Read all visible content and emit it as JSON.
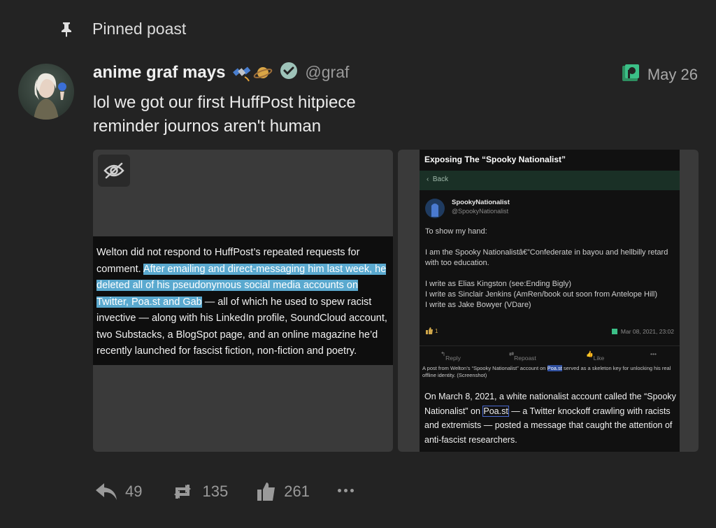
{
  "pinned": {
    "icon": "pin-icon",
    "label": "Pinned poast"
  },
  "post": {
    "author_name": "anime graf mays",
    "emoji": [
      "satellite-emoji",
      "ringed-planet-emoji"
    ],
    "verified_icon": "verified-check-icon",
    "handle": "@graf",
    "date": "May 26",
    "source_icon": "poast-logo-icon",
    "content_lines": [
      "lol we got our first HuffPost hitpiece",
      "reminder journos aren't human"
    ],
    "accent": "#3bbf87"
  },
  "media_left": {
    "hide_icon": "eye-slash-icon",
    "text_pre": "Welton did not respond to HuffPost’s repeated requests for comment.",
    "text_hl1": "After emailing and direct-messaging him last week, he deleted ",
    "text_hl2": "all",
    "text_hl3": " of his pseudonymous social media accounts on Twitter, Poa.st and Gab",
    "text_post": " — all of which he used to spew racist invective — along with his LinkedIn profile, SoundCloud account, two Substacks, a BlogSpot page, and an online magazine he’d recently launched for fascist fiction, non-fiction and poetry."
  },
  "media_right": {
    "title": "Exposing The “Spooky Nationalist”",
    "back": "Back",
    "user_name": "SpookyNationalist",
    "user_handle": "@SpookyNationalist",
    "line1": "To show my hand:",
    "line2": "I am the Spooky Nationalistâ€”Confederate in bayou and hellbilly retard with too education.",
    "line3": "I write as Elias Kingston (see:Ending Bigly)",
    "line4": "I write as Sinclair Jenkins (AmRen/book out soon from Antelope Hill)",
    "line5": "I write as Jake Bowyer (VDare)",
    "like_count": "1",
    "timestamp": "Mar 08, 2021, 23:02",
    "reply": "Reply",
    "repoast": "Repoast",
    "like": "Like",
    "more": "•••",
    "caption_pre": "A post from Welton’s “Spooky Nationalist” account on ",
    "caption_link": "Poa.st",
    "caption_post": " served as a skeleton key for unlocking his real offline identity. (Screenshot)",
    "para_pre": "On March 8, 2021, a white nationalist account called the “Spooky Nationalist” on ",
    "para_link": "Poa.st",
    "para_post": " — a Twitter knockoff crawling with racists and extremists — posted a message that caught the attention of anti-fascist researchers."
  },
  "footer": {
    "reply_icon": "reply-icon",
    "replies": "49",
    "repost_icon": "repost-icon",
    "reposts": "135",
    "like_icon": "thumbs-up-icon",
    "likes": "261",
    "more_icon": "more-icon"
  }
}
